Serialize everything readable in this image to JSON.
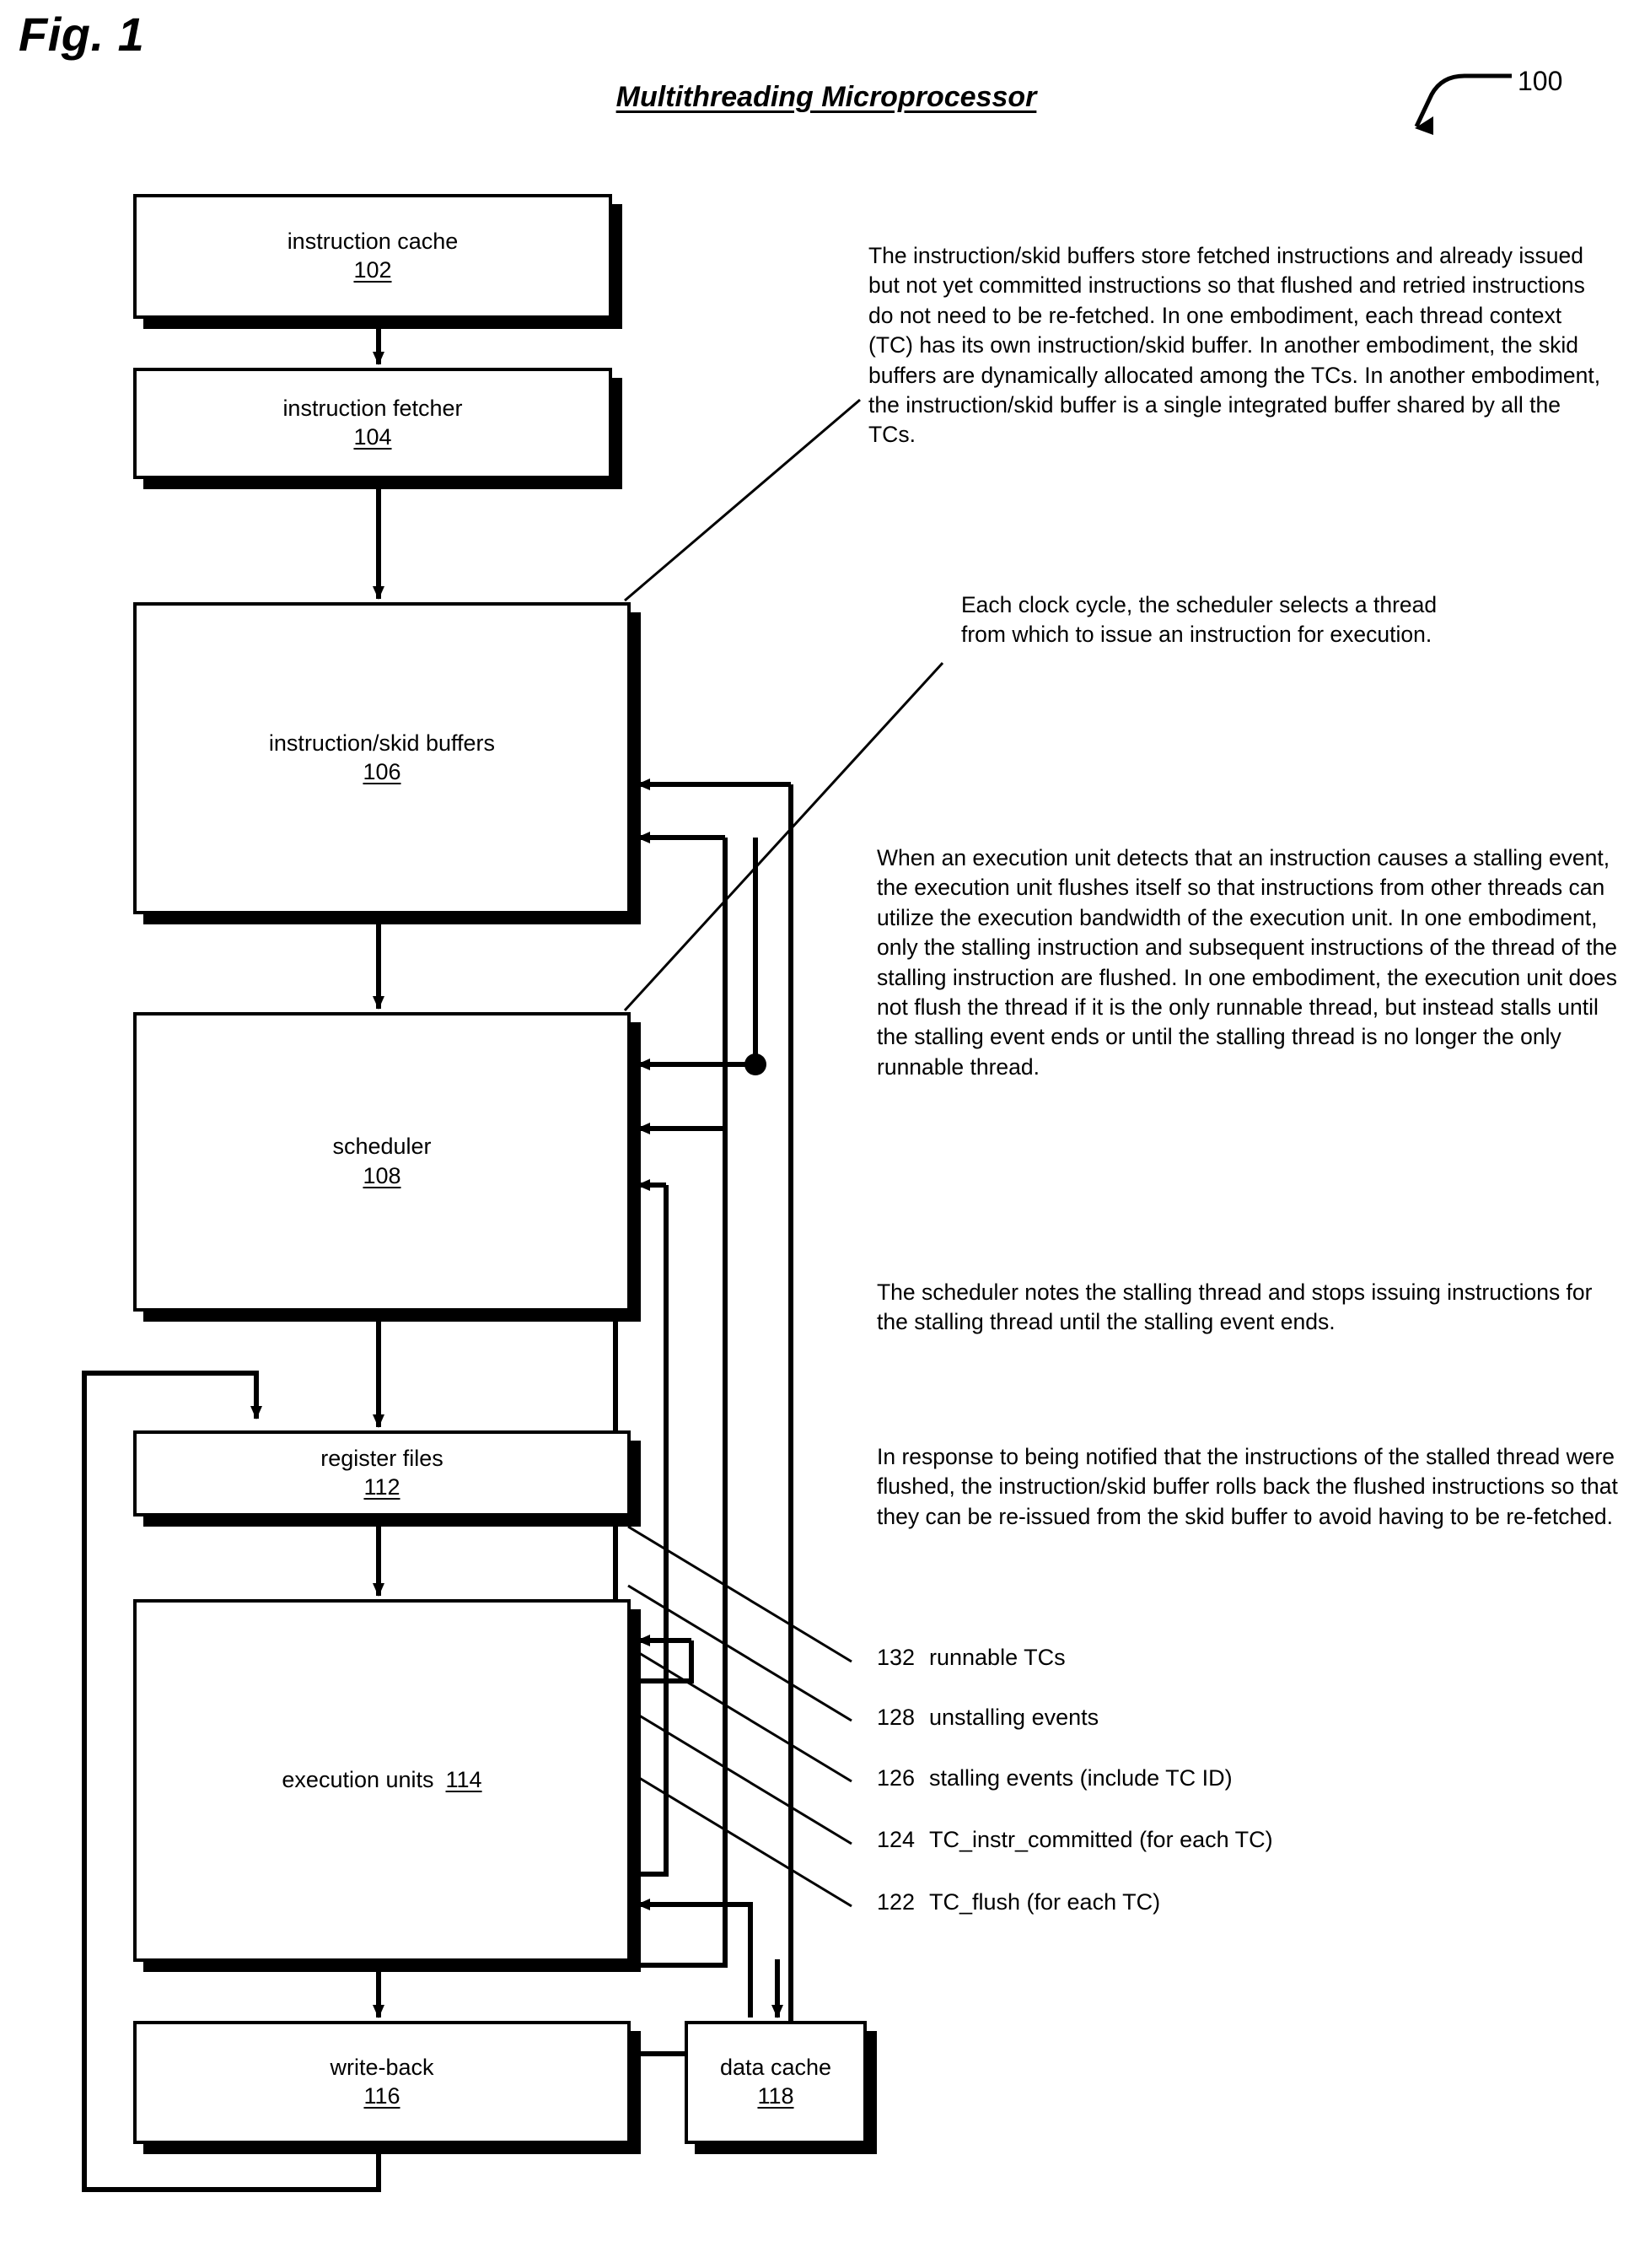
{
  "figure": {
    "label": "Fig. 1",
    "title": "Multithreading Microprocessor",
    "reference_numeral": "100"
  },
  "blocks": [
    {
      "id": "instruction-cache",
      "name": "instruction cache",
      "ref": "102"
    },
    {
      "id": "instruction-fetcher",
      "name": "instruction fetcher",
      "ref": "104"
    },
    {
      "id": "instruction-skid-buffers",
      "name": "instruction/skid buffers",
      "ref": "106"
    },
    {
      "id": "scheduler",
      "name": "scheduler",
      "ref": "108"
    },
    {
      "id": "register-files",
      "name": "register files",
      "ref": "112"
    },
    {
      "id": "execution-units",
      "name": "execution units",
      "ref": "114"
    },
    {
      "id": "write-back",
      "name": "write-back",
      "ref": "116"
    },
    {
      "id": "data-cache",
      "name": "data cache",
      "ref": "118"
    }
  ],
  "notes": {
    "skid_buffers": "The instruction/skid buffers store fetched instructions and already issued but not yet committed instructions so that flushed and retried instructions do not need to be re-fetched.  In one embodiment, each thread context (TC) has its own instruction/skid buffer.  In another embodiment, the skid buffers are dynamically allocated among the TCs.  In another embodiment, the instruction/skid buffer is a single integrated buffer shared by all the TCs.",
    "scheduler": "Each clock cycle, the scheduler selects a thread from which to issue an instruction for execution.",
    "execution_unit": "When an execution unit detects that an instruction causes a stalling event, the execution unit flushes itself so that instructions from other threads can utilize the execution bandwidth of the execution unit.  In one embodiment, only the stalling instruction and subsequent instructions of the thread of the stalling instruction are flushed.  In one embodiment, the execution unit does not flush the thread if it is the only runnable thread, but instead stalls until the stalling event ends or until the stalling thread is no longer the only runnable thread.",
    "scheduler_notes": "The scheduler notes the stalling thread and stops issuing instructions for the stalling thread until the  stalling event ends.",
    "rollback": "In response to being notified that the instructions of the stalled thread were flushed, the instruction/skid buffer rolls back the flushed instructions so that they can be re-issued from the skid buffer to avoid having to be re-fetched."
  },
  "signals": [
    {
      "ref": "132",
      "label": "runnable TCs"
    },
    {
      "ref": "128",
      "label": "unstalling events"
    },
    {
      "ref": "126",
      "label": "stalling events (include TC ID)"
    },
    {
      "ref": "124",
      "label": "TC_instr_committed (for each TC)"
    },
    {
      "ref": "122",
      "label": "TC_flush (for each TC)"
    }
  ],
  "colors": {
    "ink": "#000000",
    "paper": "#ffffff"
  }
}
